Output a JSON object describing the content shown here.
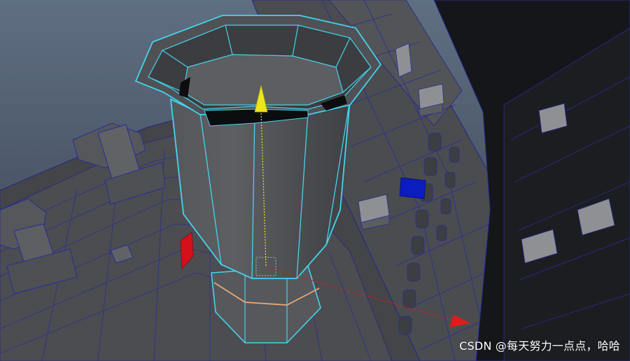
{
  "watermark": {
    "text": "CSDN @每天努力一点点，哈哈"
  }
}
